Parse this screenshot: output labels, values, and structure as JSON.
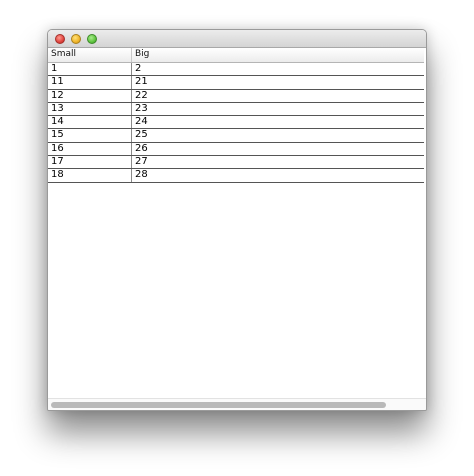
{
  "window": {
    "buttons": [
      "close",
      "minimize",
      "zoom"
    ]
  },
  "table": {
    "columns": [
      "Small",
      "Big"
    ],
    "rows": [
      [
        "1",
        "2"
      ],
      [
        "11",
        "21"
      ],
      [
        "12",
        "22"
      ],
      [
        "13",
        "23"
      ],
      [
        "14",
        "24"
      ],
      [
        "15",
        "25"
      ],
      [
        "16",
        "26"
      ],
      [
        "17",
        "27"
      ],
      [
        "18",
        "28"
      ]
    ]
  }
}
